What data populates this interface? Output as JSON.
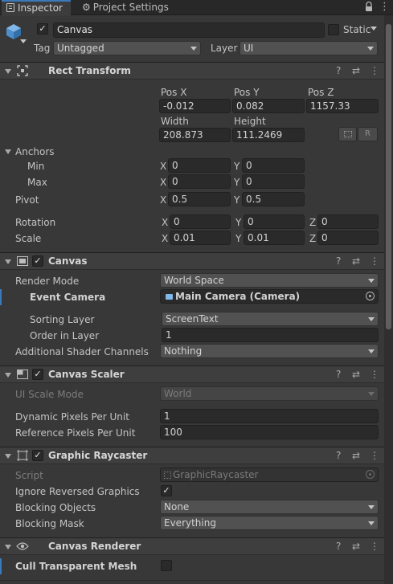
{
  "tabs": {
    "inspector": "Inspector",
    "project_settings": "Project Settings"
  },
  "header": {
    "object_name": "Canvas",
    "static_label": "Static",
    "tag_label": "Tag",
    "tag_value": "Untagged",
    "layer_label": "Layer",
    "layer_value": "UI"
  },
  "rect_transform": {
    "title": "Rect Transform",
    "pos_x_label": "Pos X",
    "pos_y_label": "Pos Y",
    "pos_z_label": "Pos Z",
    "pos_x": "-0.012",
    "pos_y": "0.082",
    "pos_z": "1157.33",
    "width_label": "Width",
    "height_label": "Height",
    "width": "208.873",
    "height": "111.2469",
    "r_button": "R",
    "anchors_label": "Anchors",
    "min_label": "Min",
    "max_label": "Max",
    "x": "X",
    "y": "Y",
    "z": "Z",
    "min_x": "0",
    "min_y": "0",
    "max_x": "0",
    "max_y": "0",
    "pivot_label": "Pivot",
    "pivot_x": "0.5",
    "pivot_y": "0.5",
    "rotation_label": "Rotation",
    "rot_x": "0",
    "rot_y": "0",
    "rot_z": "0",
    "scale_label": "Scale",
    "scale_x": "0.01",
    "scale_y": "0.01",
    "scale_z": "0"
  },
  "canvas": {
    "title": "Canvas",
    "render_mode_label": "Render Mode",
    "render_mode": "World Space",
    "event_camera_label": "Event Camera",
    "event_camera": "Main Camera (Camera)",
    "sorting_layer_label": "Sorting Layer",
    "sorting_layer": "ScreenText",
    "order_label": "Order in Layer",
    "order": "1",
    "shader_channels_label": "Additional Shader Channels",
    "shader_channels": "Nothing"
  },
  "canvas_scaler": {
    "title": "Canvas Scaler",
    "scale_mode_label": "UI Scale Mode",
    "scale_mode": "World",
    "dynamic_label": "Dynamic Pixels Per Unit",
    "dynamic": "1",
    "reference_label": "Reference Pixels Per Unit",
    "reference": "100"
  },
  "raycaster": {
    "title": "Graphic Raycaster",
    "script_label": "Script",
    "script": "GraphicRaycaster",
    "ignore_label": "Ignore Reversed Graphics",
    "blocking_objects_label": "Blocking Objects",
    "blocking_objects": "None",
    "blocking_mask_label": "Blocking Mask",
    "blocking_mask": "Everything"
  },
  "canvas_renderer": {
    "title": "Canvas Renderer",
    "cull_label": "Cull Transparent Mesh"
  },
  "colors": {
    "accent": "#3a79bb",
    "background": "#383838",
    "field": "#2a2a2a"
  },
  "icons": {
    "lock": "lock-icon",
    "menu": "kebab-menu-icon",
    "help": "help-icon",
    "preset": "preset-sliders-icon",
    "gear": "gear-icon"
  }
}
